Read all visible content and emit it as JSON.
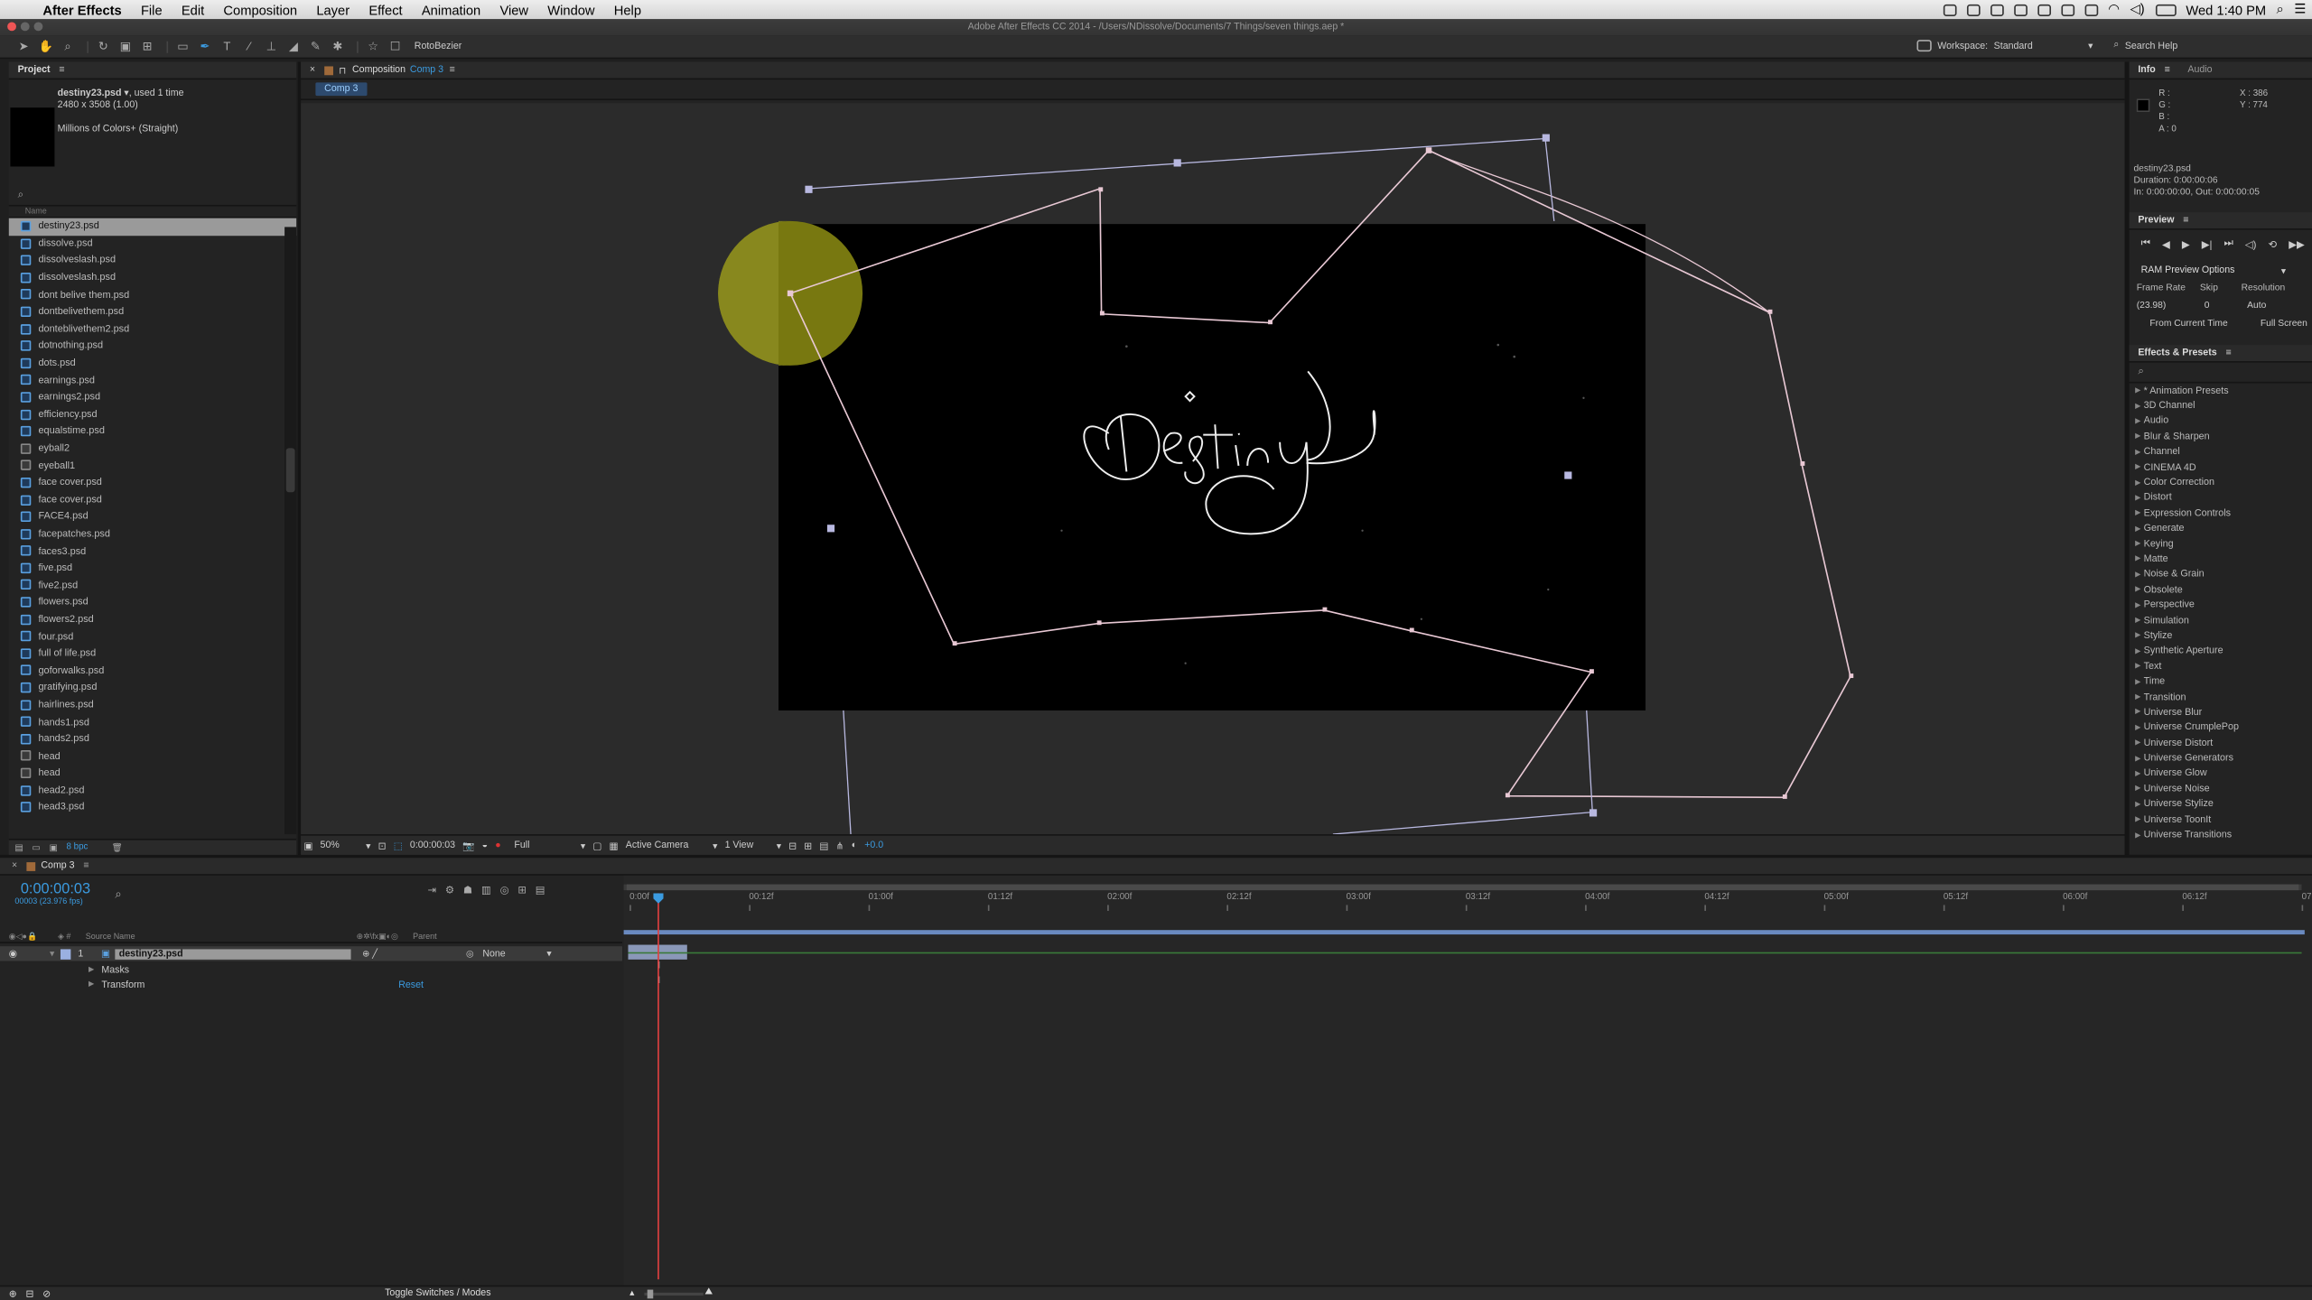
{
  "menubar": {
    "apple": "",
    "app_name": "After Effects",
    "items": [
      "File",
      "Edit",
      "Composition",
      "Layer",
      "Effect",
      "Animation",
      "View",
      "Window",
      "Help"
    ],
    "clock": "Wed 1:40 PM"
  },
  "window": {
    "title": "Adobe After Effects CC 2014 - /Users/NDissolve/Documents/7 Things/seven things.aep *"
  },
  "toolbar": {
    "rotobezier_label": "RotoBezier",
    "workspace_label": "Workspace:",
    "workspace_value": "Standard",
    "search_help": "Search Help"
  },
  "project": {
    "tab": "Project",
    "selected_name": "destiny23.psd ▾",
    "used": ", used 1 time",
    "dims": "2480 x 3508 (1.00)",
    "colors": "Millions of Colors+ (Straight)",
    "col_name": "Name",
    "bpc": "8 bpc",
    "files": [
      {
        "name": "destiny23.psd",
        "type": "psd",
        "selected": true
      },
      {
        "name": "dissolve.psd",
        "type": "psd"
      },
      {
        "name": "dissolveslash.psd",
        "type": "psd"
      },
      {
        "name": "dissolveslash.psd",
        "type": "psd"
      },
      {
        "name": "dont belive them.psd",
        "type": "psd"
      },
      {
        "name": "dontbelivethem.psd",
        "type": "psd"
      },
      {
        "name": "donteblivethem2.psd",
        "type": "psd"
      },
      {
        "name": "dotnothing.psd",
        "type": "psd"
      },
      {
        "name": "dots.psd",
        "type": "psd"
      },
      {
        "name": "earnings.psd",
        "type": "psd"
      },
      {
        "name": "earnings2.psd",
        "type": "psd"
      },
      {
        "name": "efficiency.psd",
        "type": "psd"
      },
      {
        "name": "equalstime.psd",
        "type": "psd"
      },
      {
        "name": "eyball2",
        "type": "img"
      },
      {
        "name": "eyeball1",
        "type": "img"
      },
      {
        "name": "face cover.psd",
        "type": "psd"
      },
      {
        "name": "face cover.psd",
        "type": "psd"
      },
      {
        "name": "FACE4.psd",
        "type": "psd"
      },
      {
        "name": "facepatches.psd",
        "type": "psd"
      },
      {
        "name": "faces3.psd",
        "type": "psd"
      },
      {
        "name": "five.psd",
        "type": "psd"
      },
      {
        "name": "five2.psd",
        "type": "psd"
      },
      {
        "name": "flowers.psd",
        "type": "psd"
      },
      {
        "name": "flowers2.psd",
        "type": "psd"
      },
      {
        "name": "four.psd",
        "type": "psd"
      },
      {
        "name": "full of life.psd",
        "type": "psd"
      },
      {
        "name": "goforwalks.psd",
        "type": "psd"
      },
      {
        "name": "gratifying.psd",
        "type": "psd"
      },
      {
        "name": "hairlines.psd",
        "type": "psd"
      },
      {
        "name": "hands1.psd",
        "type": "psd"
      },
      {
        "name": "hands2.psd",
        "type": "psd"
      },
      {
        "name": "head",
        "type": "img"
      },
      {
        "name": "head",
        "type": "img"
      },
      {
        "name": "head2.psd",
        "type": "psd"
      },
      {
        "name": "head3.psd",
        "type": "psd"
      }
    ]
  },
  "composition": {
    "tab_prefix": "Composition",
    "tab_name": "Comp 3",
    "breadcrumb": "Comp 3",
    "zoom": "50%",
    "timecode": "0:00:00:03",
    "resolution": "Full",
    "camera": "Active Camera",
    "views": "1 View",
    "exposure": "+0.0",
    "canvas_text": "Destiny"
  },
  "info": {
    "tab": "Info",
    "tab2": "Audio",
    "r": "R :",
    "g": "G :",
    "b": "B :",
    "a": "A : 0",
    "x": "X : 386",
    "y": "Y : 774",
    "file": "destiny23.psd",
    "duration": "Duration: 0:00:00:06",
    "inout": "In: 0:00:00:00, Out: 0:00:00:05"
  },
  "preview": {
    "tab": "Preview",
    "ram": "RAM Preview Options",
    "frame_rate_lbl": "Frame Rate",
    "skip_lbl": "Skip",
    "resolution_lbl": "Resolution",
    "frame_rate": "(23.98)",
    "skip": "0",
    "resolution": "Auto",
    "from_current": "From Current Time",
    "full_screen": "Full Screen"
  },
  "effects": {
    "tab": "Effects & Presets",
    "items": [
      "* Animation Presets",
      "3D Channel",
      "Audio",
      "Blur & Sharpen",
      "Channel",
      "CINEMA 4D",
      "Color Correction",
      "Distort",
      "Expression Controls",
      "Generate",
      "Keying",
      "Matte",
      "Noise & Grain",
      "Obsolete",
      "Perspective",
      "Simulation",
      "Stylize",
      "Synthetic Aperture",
      "Text",
      "Time",
      "Transition",
      "Universe Blur",
      "Universe CrumplePop",
      "Universe Distort",
      "Universe Generators",
      "Universe Glow",
      "Universe Noise",
      "Universe Stylize",
      "Universe ToonIt",
      "Universe Transitions"
    ]
  },
  "timeline": {
    "tab": "Comp 3",
    "timecode": "0:00:00:03",
    "frames_fps": "00003 (23.976 fps)",
    "col_source": "Source Name",
    "col_parent": "Parent",
    "layer_num": "1",
    "layer_name": "destiny23.psd",
    "parent_value": "None",
    "masks": "Masks",
    "transform": "Transform",
    "reset": "Reset",
    "toggle": "Toggle Switches / Modes",
    "ruler": [
      "0:00f",
      "00:12f",
      "01:00f",
      "01:12f",
      "02:00f",
      "02:12f",
      "03:00f",
      "03:12f",
      "04:00f",
      "04:12f",
      "05:00f",
      "05:12f",
      "06:00f",
      "06:12f",
      "07"
    ]
  },
  "colors": {
    "accent": "#3b9be0",
    "mask_path": "#e8c8d4",
    "shape_fill": "#7a7a10",
    "playhead": "#e04040"
  }
}
